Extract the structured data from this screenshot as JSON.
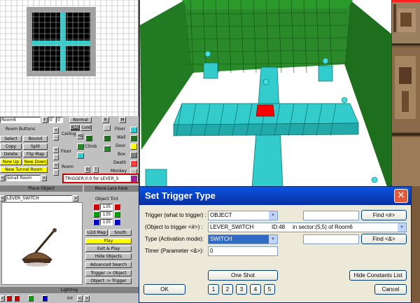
{
  "left_panel": {
    "room": {
      "name": "Room6",
      "f_label": "F",
      "f_value": "0",
      "s_value": "0",
      "mode_label": "Normal",
      "r_label": "R",
      "m_label": "M",
      "sections_title": "Room Buttons",
      "buttons": [
        "Select",
        "Bound",
        "Copy",
        "Split",
        "Delete",
        "Flip Map",
        "New Up",
        "New Down",
        "New Tunnel Room"
      ],
      "size": "Small Room"
    },
    "attrib": {
      "dmg": "DMG",
      "cold": "Cold",
      "ceiling": "Ceiling",
      "floor_lbl": "Floor",
      "room_lbl": "Room",
      "hi": "HL",
      "climb": "Climb",
      "b": "B",
      "t": "T"
    },
    "tex_list": [
      "Floor",
      "Wall",
      "Door",
      "Box",
      "Death",
      "Monkey"
    ],
    "trigger_text": "TRIGGER:0:0  for  LEVER_S",
    "place_object": "Place Object",
    "move_lara": "Move Lara here",
    "object_name": "LEVER_SWITCH",
    "object_tint": {
      "title": "Object Tint",
      "values": [
        "135",
        "135",
        "135"
      ]
    },
    "object_buttons": [
      "U2d Map",
      "South",
      "Play",
      "Exit & Play",
      "Hide Objects",
      "Advanced Search",
      "Trigger -> Object",
      "Object -> Trigger"
    ],
    "lighting": "Lighting",
    "int_label": "Int"
  },
  "dialog": {
    "title": "Set Trigger Type",
    "close_glyph": "✕",
    "trigger_label": "Trigger (what to trigger) :",
    "trigger_value": "OBJECT",
    "object_label": "(Object to trigger <#>) :",
    "object_value": "LEVER_SWITCH",
    "object_id": "ID:48",
    "object_sector": "in sector:(5,5) of Room6",
    "type_label": "Type (Activation mode):",
    "type_value": "SWITCH",
    "timer_label": "Timer (Parameter <&>):",
    "timer_value": "0",
    "find_hash": "Find <#>",
    "find_amp": "Find <&>",
    "one_shot": "One Shot",
    "code_bits": [
      "1",
      "2",
      "3",
      "4",
      "5"
    ],
    "hide_constants": "Hide Constants List",
    "ok": "OK",
    "cancel": "Cancel"
  },
  "colors": {
    "cyan_block": "#33cccc",
    "green_wall": "#2a8a2a",
    "red_tile": "#ff0000",
    "accent_title": "#0a54e3"
  }
}
